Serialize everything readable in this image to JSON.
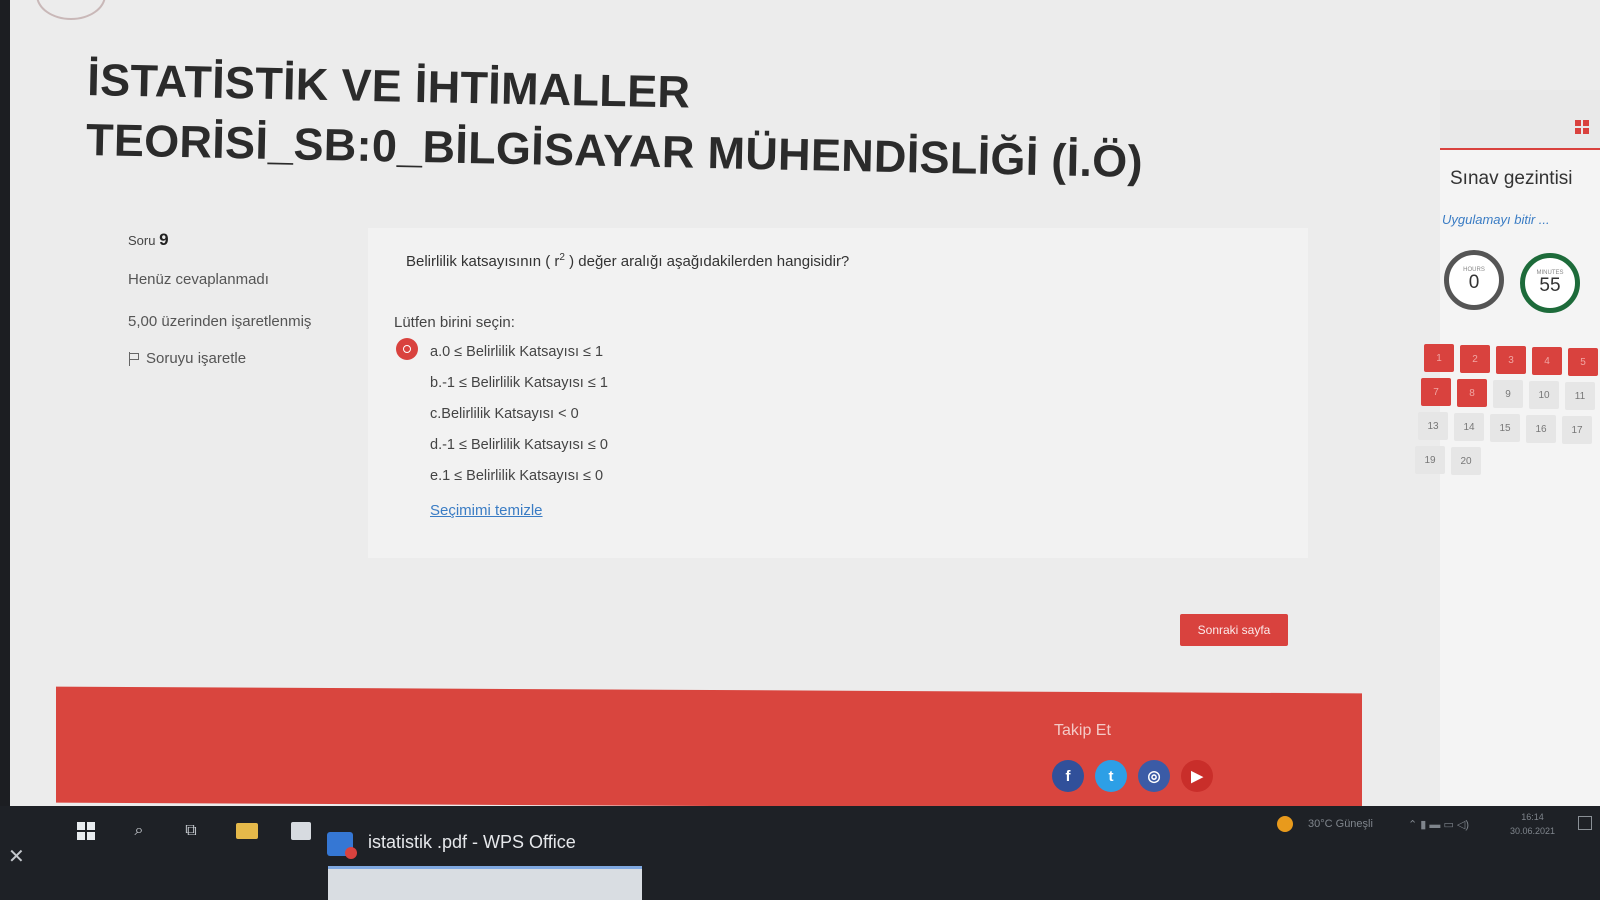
{
  "page": {
    "title": "İSTATİSTİK VE İHTİMALLER TEORİSİ_SB:0_BİLGİSAYAR MÜHENDİSLİĞİ (İ.Ö)"
  },
  "question_info": {
    "label": "Soru",
    "number": "9",
    "status": "Henüz cevaplanmadı",
    "grade": "5,00 üzerinden işaretlenmiş",
    "flag_label": "Soruyu işaretle"
  },
  "question": {
    "text_before": "Belirlilik katsayısının ( r",
    "superscript": "2",
    "text_after": " ) değer aralığı aşağıdakilerden hangisidir?",
    "prompt": "Lütfen birini seçin:",
    "answers": [
      {
        "label": "a.0 ≤ Belirlilik Katsayısı ≤ 1",
        "selected": true
      },
      {
        "label": "b.-1 ≤ Belirlilik Katsayısı ≤ 1",
        "selected": false
      },
      {
        "label": "c.Belirlilik Katsayısı < 0",
        "selected": false
      },
      {
        "label": "d.-1 ≤ Belirlilik Katsayısı ≤ 0",
        "selected": false
      },
      {
        "label": "e.1 ≤ Belirlilik Katsayısı ≤ 0",
        "selected": false
      }
    ],
    "clear_label": "Seçimimi temizle"
  },
  "next_button": "Sonraki sayfa",
  "footer": {
    "follow_label": "Takip Et",
    "socials": [
      "facebook-icon",
      "twitter-icon",
      "instagram-icon",
      "youtube-icon"
    ]
  },
  "quiz_nav": {
    "title": "Sınav gezintisi",
    "finish_link": "Uygulamayı bitir ...",
    "timer": {
      "hours_label": "HOURS",
      "hours": "0",
      "minutes_label": "MINUTES",
      "minutes": "55"
    },
    "questions": [
      {
        "n": "1",
        "answered": true
      },
      {
        "n": "2",
        "answered": true
      },
      {
        "n": "3",
        "answered": true
      },
      {
        "n": "4",
        "answered": true
      },
      {
        "n": "5",
        "answered": true
      },
      {
        "n": "7",
        "answered": true
      },
      {
        "n": "8",
        "answered": true
      },
      {
        "n": "9",
        "answered": false
      },
      {
        "n": "10",
        "answered": false
      },
      {
        "n": "11",
        "answered": false
      },
      {
        "n": "13",
        "answered": false
      },
      {
        "n": "14",
        "answered": false
      },
      {
        "n": "15",
        "answered": false
      },
      {
        "n": "16",
        "answered": false
      },
      {
        "n": "17",
        "answered": false
      },
      {
        "n": "19",
        "answered": false
      },
      {
        "n": "20",
        "answered": false
      }
    ]
  },
  "taskbar": {
    "app_label": "istatistik .pdf - WPS Office",
    "weather": "30°C Güneşli",
    "time": "16:14",
    "date": "30.06.2021"
  },
  "colors": {
    "accent": "#d9423e",
    "link": "#3a7cc4",
    "facebook": "#31509a",
    "twitter": "#2d9fe6",
    "youtube": "#c92e2a"
  }
}
